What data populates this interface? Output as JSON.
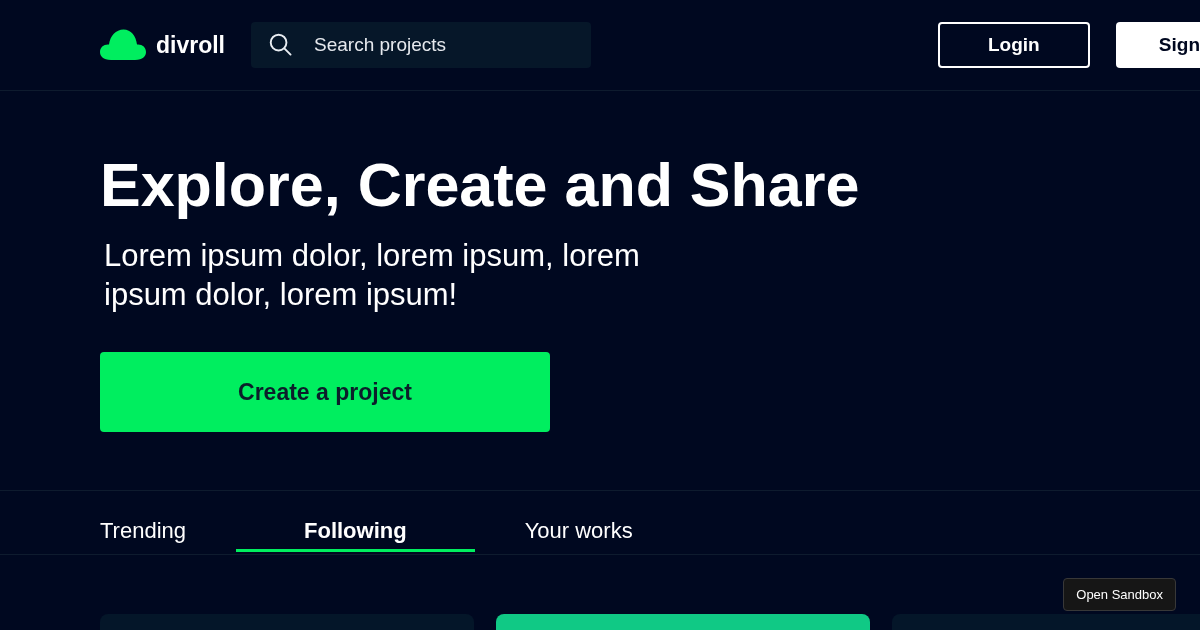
{
  "header": {
    "brand": "divroll",
    "search": {
      "placeholder": "Search projects"
    },
    "buttons": [
      {
        "label": "Login",
        "kind": "outline"
      },
      {
        "label": "Sign",
        "kind": "filled"
      }
    ]
  },
  "hero": {
    "title": "Explore, Create and Share",
    "subtitle": "Lorem ipsum dolor, lorem ipsum, lorem ipsum dolor, lorem ipsum!",
    "cta": "Create a project"
  },
  "tabs": [
    {
      "label": "Trending",
      "selected": false
    },
    {
      "label": "Following",
      "selected": true
    },
    {
      "label": "Your works",
      "selected": false
    }
  ],
  "project_cards": [
    {
      "color": "#041629"
    },
    {
      "color": "#10c985"
    },
    {
      "color": "#041629"
    }
  ],
  "sandbox_button": {
    "label": "Open Sandbox"
  }
}
